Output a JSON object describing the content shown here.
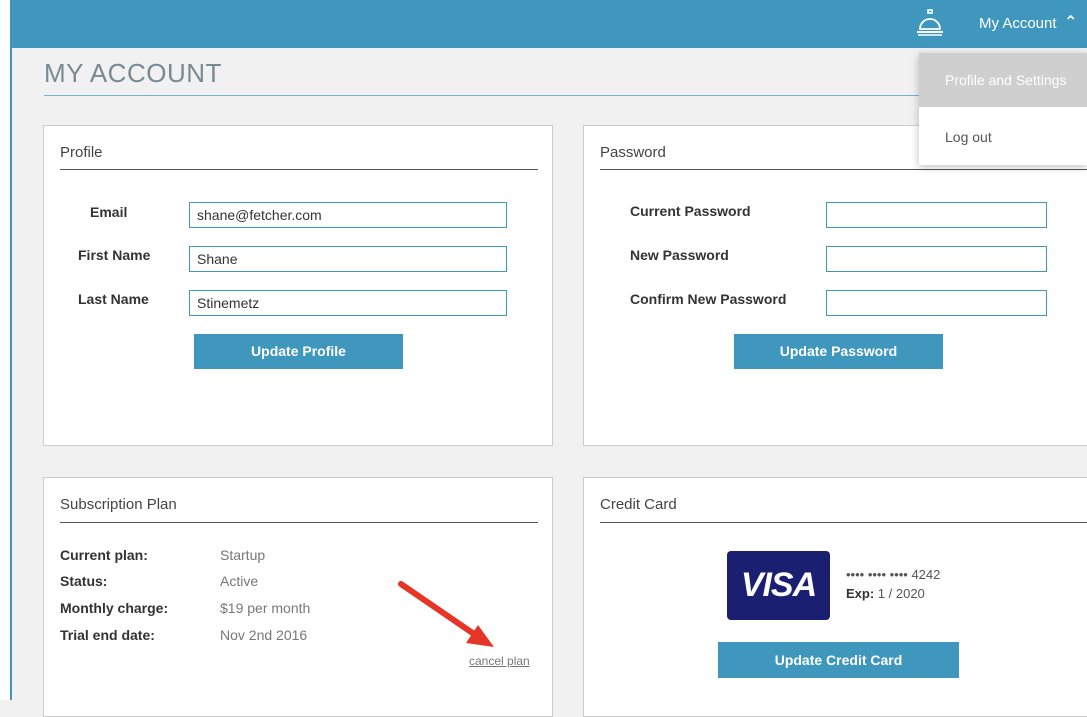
{
  "header": {
    "account_label": "My Account",
    "caret_icon": "chevron-up-icon",
    "bell_icon": "service-bell-icon"
  },
  "page": {
    "title": "MY ACCOUNT"
  },
  "dropdown": {
    "items": [
      {
        "label": "Profile and Settings"
      },
      {
        "label": "Log out"
      }
    ]
  },
  "profile": {
    "title": "Profile",
    "email_label": "Email",
    "email_value": "shane@fetcher.com",
    "first_label": "First Name",
    "first_value": "Shane",
    "last_label": "Last Name",
    "last_value": "Stinemetz",
    "button": "Update Profile"
  },
  "password": {
    "title": "Password",
    "current_label": "Current Password",
    "new_label": "New Password",
    "confirm_label": "Confirm New Password",
    "button": "Update Password"
  },
  "subscription": {
    "title": "Subscription Plan",
    "rows": [
      {
        "label": "Current plan:",
        "value": "Startup"
      },
      {
        "label": "Status:",
        "value": "Active"
      },
      {
        "label": "Monthly charge:",
        "value": "$19 per month"
      },
      {
        "label": "Trial end date:",
        "value": "Nov 2nd 2016"
      }
    ],
    "cancel": "cancel plan"
  },
  "credit_card": {
    "title": "Credit Card",
    "brand": "VISA",
    "number": "•••• •••• •••• 4242",
    "exp_label": "Exp:",
    "exp_value": "1 / 2020",
    "button": "Update Credit Card"
  },
  "colors": {
    "accent": "#3f97be",
    "visa": "#1a1f71",
    "arrow": "#e53527"
  }
}
